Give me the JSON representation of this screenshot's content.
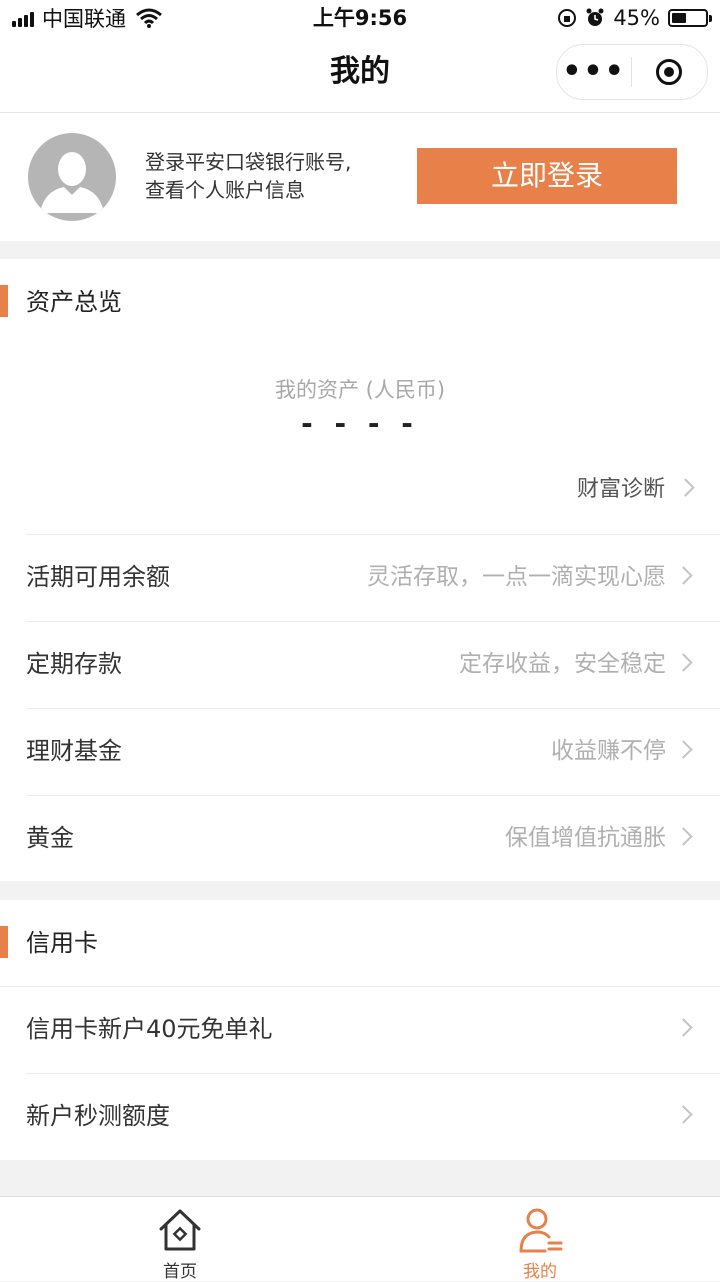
{
  "status_bar": {
    "carrier": "中国联通",
    "time": "上午9:56",
    "battery": "45%",
    "battery_level": 0.45
  },
  "nav": {
    "title": "我的",
    "more_label": "•••"
  },
  "login": {
    "hint_line1": "登录平安口袋银行账号,",
    "hint_line2": "查看个人账户信息",
    "button": "立即登录"
  },
  "assets": {
    "section_title": "资产总览",
    "my_assets_label": "我的资产 (人民币)",
    "value": "- - - -",
    "diagnosis": "财富诊断",
    "items": [
      {
        "label": "活期可用余额",
        "desc": "灵活存取，一点一滴实现心愿"
      },
      {
        "label": "定期存款",
        "desc": "定存收益，安全稳定"
      },
      {
        "label": "理财基金",
        "desc": "收益赚不停"
      },
      {
        "label": "黄金",
        "desc": "保值增值抗通胀"
      }
    ]
  },
  "credit": {
    "section_title": "信用卡",
    "items": [
      {
        "label": "信用卡新户40元免单礼"
      },
      {
        "label": "新户秒测额度"
      }
    ]
  },
  "tabbar": {
    "home": "首页",
    "mine": "我的",
    "active_color": "#e8804a",
    "inactive_color": "#333333"
  },
  "colors": {
    "accent": "#e8804a"
  }
}
